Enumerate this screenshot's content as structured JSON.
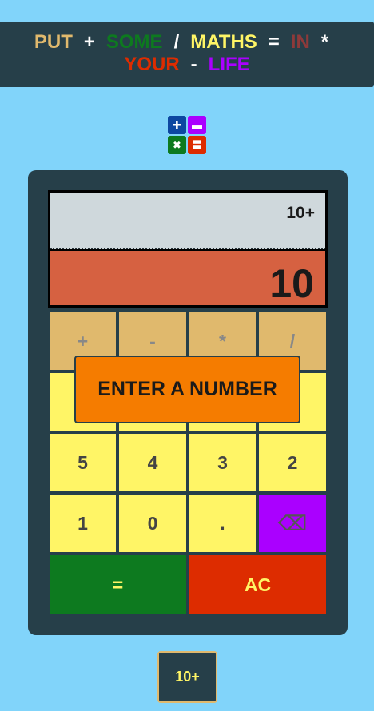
{
  "banner": {
    "line1": [
      {
        "text": "PUT",
        "color": "#e0b96d"
      },
      {
        "text": "+",
        "color": "#ffffff"
      },
      {
        "text": "SOME",
        "color": "#0d7a1f"
      },
      {
        "text": "/",
        "color": "#ffffff"
      },
      {
        "text": "MATHS",
        "color": "#fff566"
      },
      {
        "text": "=",
        "color": "#ffffff"
      },
      {
        "text": "IN",
        "color": "#8d3a3a"
      },
      {
        "text": "*",
        "color": "#ffffff"
      }
    ],
    "line2": [
      {
        "text": "YOUR",
        "color": "#dd2c00"
      },
      {
        "text": "-",
        "color": "#ffffff"
      },
      {
        "text": "LIFE",
        "color": "#aa00ff"
      }
    ]
  },
  "logo": {
    "tiles": [
      {
        "icon": "plus-icon",
        "glyph": "✚",
        "color": "#0d47a1"
      },
      {
        "icon": "minus-icon",
        "glyph": "▬",
        "color": "#aa00ff"
      },
      {
        "icon": "multiply-icon",
        "glyph": "✖",
        "color": "#0d7a1f"
      },
      {
        "icon": "equals-icon",
        "glyph": "〓",
        "color": "#dd2c00"
      }
    ]
  },
  "display": {
    "history": "10+",
    "current": "10"
  },
  "keys": {
    "plus": "+",
    "minus": "-",
    "multiply": "*",
    "divide": "/",
    "five": "5",
    "four": "4",
    "three": "3",
    "two": "2",
    "one": "1",
    "zero": "0",
    "dot": ".",
    "backspace": "⌫",
    "equals": "=",
    "clear": "AC"
  },
  "overlay": {
    "message": "ENTER A NUMBER"
  },
  "mini_display": {
    "text": "10+"
  },
  "colors": {
    "background": "#81d4fa",
    "panel": "#263f49",
    "operator": "#e0b96d",
    "number": "#fff566",
    "equals": "#0d7a1f",
    "clear": "#dd2c00",
    "backspace": "#aa00ff",
    "overlay": "#f57c00",
    "current_display": "#d66141"
  }
}
